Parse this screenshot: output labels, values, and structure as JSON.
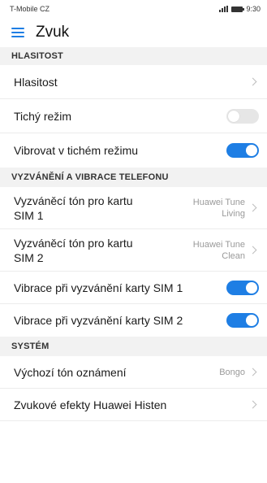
{
  "status_bar": {
    "carrier": "T-Mobile CZ",
    "time": "9:30"
  },
  "app_bar": {
    "title": "Zvuk",
    "menu_icon": "hamburger-menu-icon"
  },
  "colors": {
    "accent": "#1e7ee4",
    "section_bg": "#f2f2f2"
  },
  "sections": {
    "volume": {
      "header": "HLASITOST",
      "items": [
        {
          "label": "Hlasitost"
        },
        {
          "label": "Tichý režim",
          "toggle": "off"
        },
        {
          "label": "Vibrovat v tichém režimu",
          "toggle": "on"
        }
      ]
    },
    "ringtones": {
      "header": "VYZVÁNĚNÍ A VIBRACE TELEFONU",
      "items": [
        {
          "label_line1": "Vyzváněcí tón pro kartu",
          "label_line2": "SIM 1",
          "value_line1": "Huawei Tune",
          "value_line2": "Living"
        },
        {
          "label_line1": "Vyzváněcí tón pro kartu",
          "label_line2": "SIM 2",
          "value_line1": "Huawei Tune",
          "value_line2": "Clean"
        },
        {
          "label": "Vibrace při vyzvánění karty SIM 1",
          "toggle": "on"
        },
        {
          "label": "Vibrace při vyzvánění karty SIM 2",
          "toggle": "on"
        }
      ]
    },
    "system": {
      "header": "SYSTÉM",
      "items": [
        {
          "label": "Výchozí tón oznámení",
          "value": "Bongo"
        },
        {
          "label": "Zvukové efekty Huawei Histen"
        }
      ]
    }
  }
}
